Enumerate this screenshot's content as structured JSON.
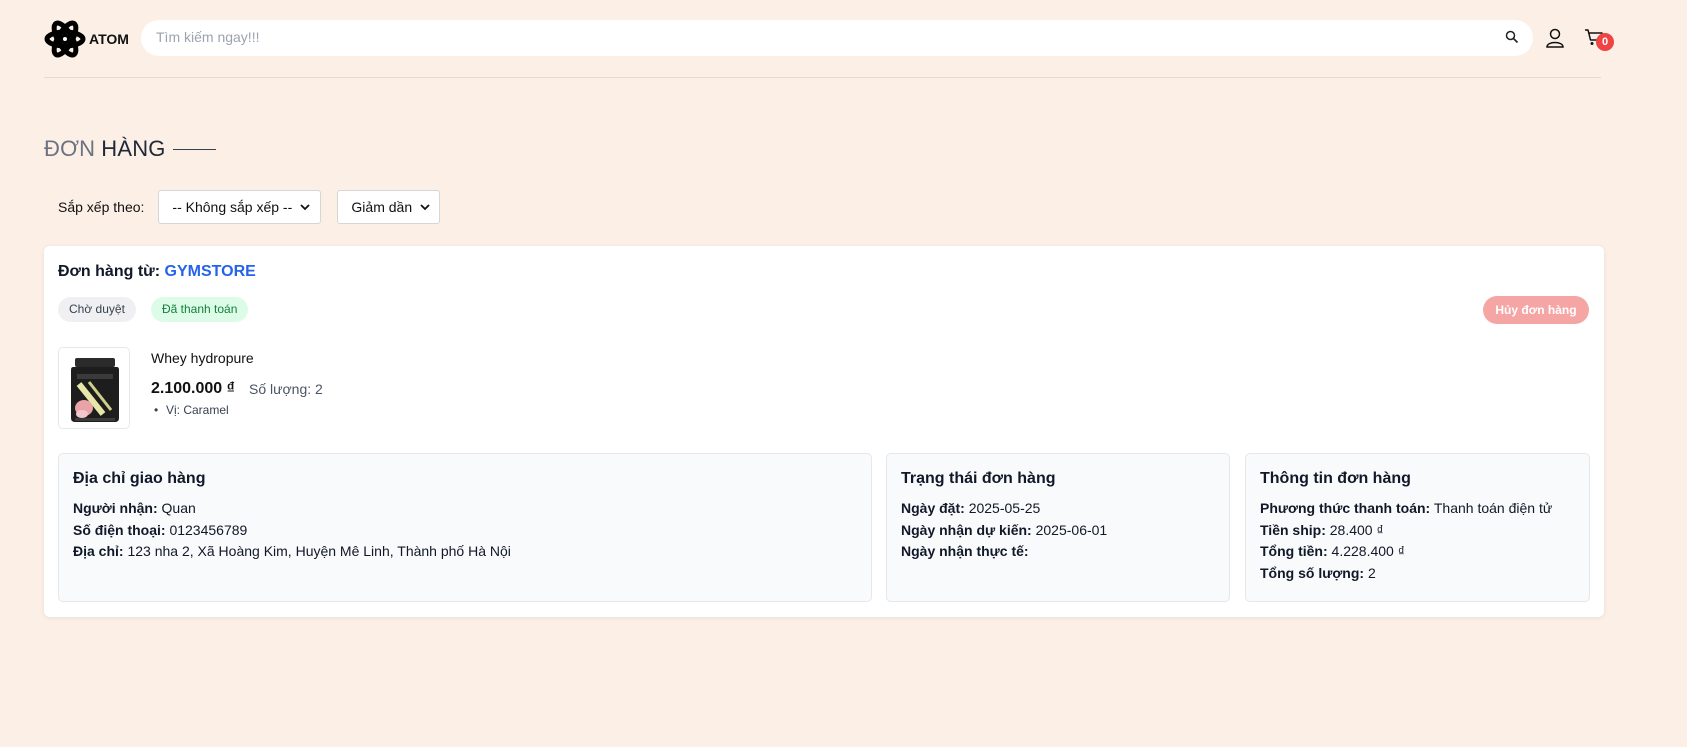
{
  "header": {
    "logo_text": "ATOM",
    "search_placeholder": "Tìm kiếm ngay!!!",
    "cart_count": "0"
  },
  "page": {
    "title_part1": "ĐƠN",
    "title_part2": "HÀNG"
  },
  "sort": {
    "label": "Sắp xếp theo:",
    "field_selected": "-- Không sắp xếp --",
    "order_selected": "Giảm dần"
  },
  "order": {
    "store_prefix": "Đơn hàng từ:",
    "store_name": "GYMSTORE",
    "status_badge": "Chờ duyệt",
    "payment_badge": "Đã thanh toán",
    "cancel_label": "Hủy đơn hàng",
    "item": {
      "name": "Whey hydropure",
      "price": "2.100.000 ₫",
      "quantity": "Số lượng: 2",
      "variant": "Vị: Caramel"
    },
    "address": {
      "heading": "Địa chỉ giao hàng",
      "recipient_label": "Người nhận:",
      "recipient": "Quan",
      "phone_label": "Số điện thoại:",
      "phone": "0123456789",
      "address_label": "Địa chỉ:",
      "address": "123 nha 2, Xã Hoàng Kim, Huyện Mê Linh, Thành phố Hà Nội"
    },
    "status": {
      "heading": "Trạng thái đơn hàng",
      "order_date_label": "Ngày đặt:",
      "order_date": "2025-05-25",
      "expected_label": "Ngày nhận dự kiến:",
      "expected_date": "2025-06-01",
      "actual_label": "Ngày nhận thực tế:",
      "actual_date": ""
    },
    "info": {
      "heading": "Thông tin đơn hàng",
      "payment_label": "Phương thức thanh toán:",
      "payment": "Thanh toán điện tử",
      "ship_label": "Tiền ship:",
      "ship": "28.400 ₫",
      "total_label": "Tổng tiền:",
      "total": "4.228.400 ₫",
      "count_label": "Tổng số lượng:",
      "count": "2"
    }
  },
  "colors": {
    "background": "#fcefe6",
    "accent_blue": "#2563eb",
    "cancel": "#f6a5a5",
    "paid_bg": "#dcfce7",
    "cart_badge": "#ef4444"
  }
}
